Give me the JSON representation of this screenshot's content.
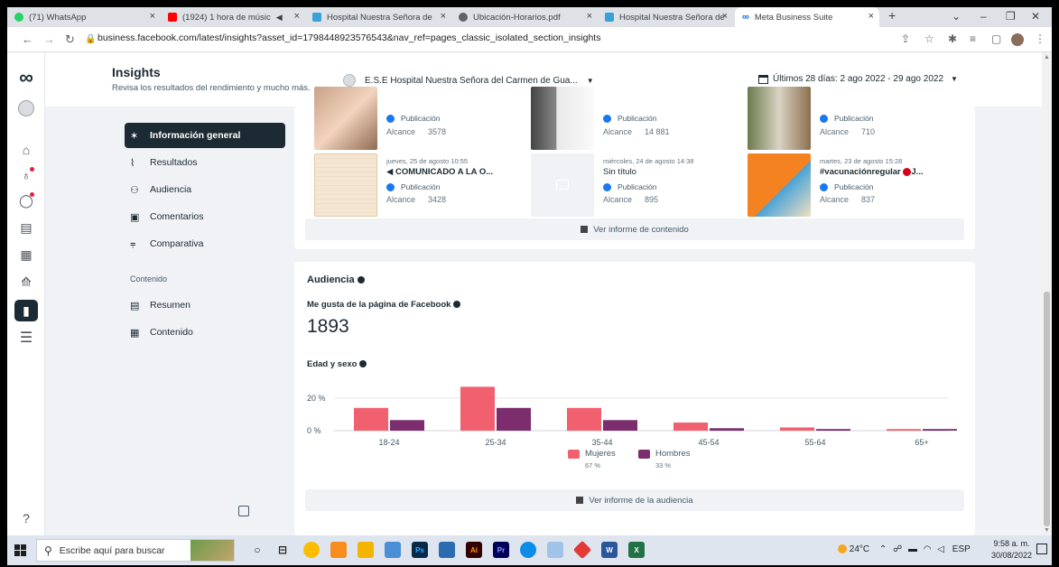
{
  "browser": {
    "tabs": [
      {
        "label": "(71) WhatsApp",
        "color": "#25d366"
      },
      {
        "label": "(1924) 1 hora de músic",
        "color": "#ff0000"
      },
      {
        "label": "Hospital Nuestra Señora de",
        "color": "#3aa0d8"
      },
      {
        "label": "Ubicación-Horarios.pdf",
        "color": "#5f6368"
      },
      {
        "label": "Hospital Nuestra Señora de",
        "color": "#3aa0d8"
      },
      {
        "label": "Meta Business Suite",
        "color": "#0668e1"
      }
    ],
    "url": "business.facebook.com/latest/insights?asset_id=1798448923576543&nav_ref=pages_classic_isolated_section_insights"
  },
  "header": {
    "title": "Insights",
    "subtitle": "Revisa los resultados del rendimiento y mucho más.",
    "page_selector": "E.S.E Hospital Nuestra Señora del Carmen de Gua...",
    "date_selector": "Últimos 28 días: 2 ago 2022 - 29 ago 2022"
  },
  "sidebar": {
    "items": [
      {
        "label": "Información general"
      },
      {
        "label": "Resultados"
      },
      {
        "label": "Audiencia"
      },
      {
        "label": "Comentarios"
      },
      {
        "label": "Comparativa"
      }
    ],
    "section_label": "Contenido",
    "content_items": [
      {
        "label": "Resumen"
      },
      {
        "label": "Contenido"
      }
    ]
  },
  "posts_top": [
    {
      "type": "Publicación",
      "reach_label": "Alcance",
      "reach": "3578"
    },
    {
      "type": "Publicación",
      "reach_label": "Alcance",
      "reach": "14 881"
    },
    {
      "type": "Publicación",
      "reach_label": "Alcance",
      "reach": "710"
    }
  ],
  "posts": [
    {
      "date": "jueves, 25 de agosto 10:55",
      "title": "COMUNICADO A LA O...",
      "type": "Publicación",
      "reach_label": "Alcance",
      "reach": "3428"
    },
    {
      "date": "miércoles, 24 de agosto 14:38",
      "title": "Sin título",
      "type": "Publicación",
      "reach_label": "Alcance",
      "reach": "895"
    },
    {
      "date": "martes, 23 de agosto 15:28",
      "title": "#vacunaciónregular",
      "type": "Publicación",
      "reach_label": "Alcance",
      "reach": "837"
    }
  ],
  "content_report_link": "Ver informe de contenido",
  "audience": {
    "title": "Audiencia",
    "likes_label": "Me gusta de la página de Facebook",
    "likes_value": "1893",
    "age_gender_label": "Edad y sexo",
    "report_link": "Ver informe de la audiencia"
  },
  "chart_data": {
    "type": "bar",
    "categories": [
      "18-24",
      "25-34",
      "35-44",
      "45-54",
      "55-64",
      "65+"
    ],
    "series": [
      {
        "name": "Mujeres",
        "share": "67 %",
        "color": "#f0606e",
        "values": [
          14,
          27,
          14,
          5,
          2,
          1
        ]
      },
      {
        "name": "Hombres",
        "share": "33 %",
        "color": "#7b2d6e",
        "values": [
          6.5,
          14,
          6.5,
          1.5,
          1,
          1
        ]
      }
    ],
    "yticks": [
      "20 %",
      "0 %"
    ],
    "ylim": [
      0,
      30
    ]
  },
  "taskbar": {
    "search_placeholder": "Escribe aquí para buscar",
    "weather": "24°C",
    "language": "ESP",
    "time": "9:58 a. m.",
    "date": "30/08/2022"
  }
}
